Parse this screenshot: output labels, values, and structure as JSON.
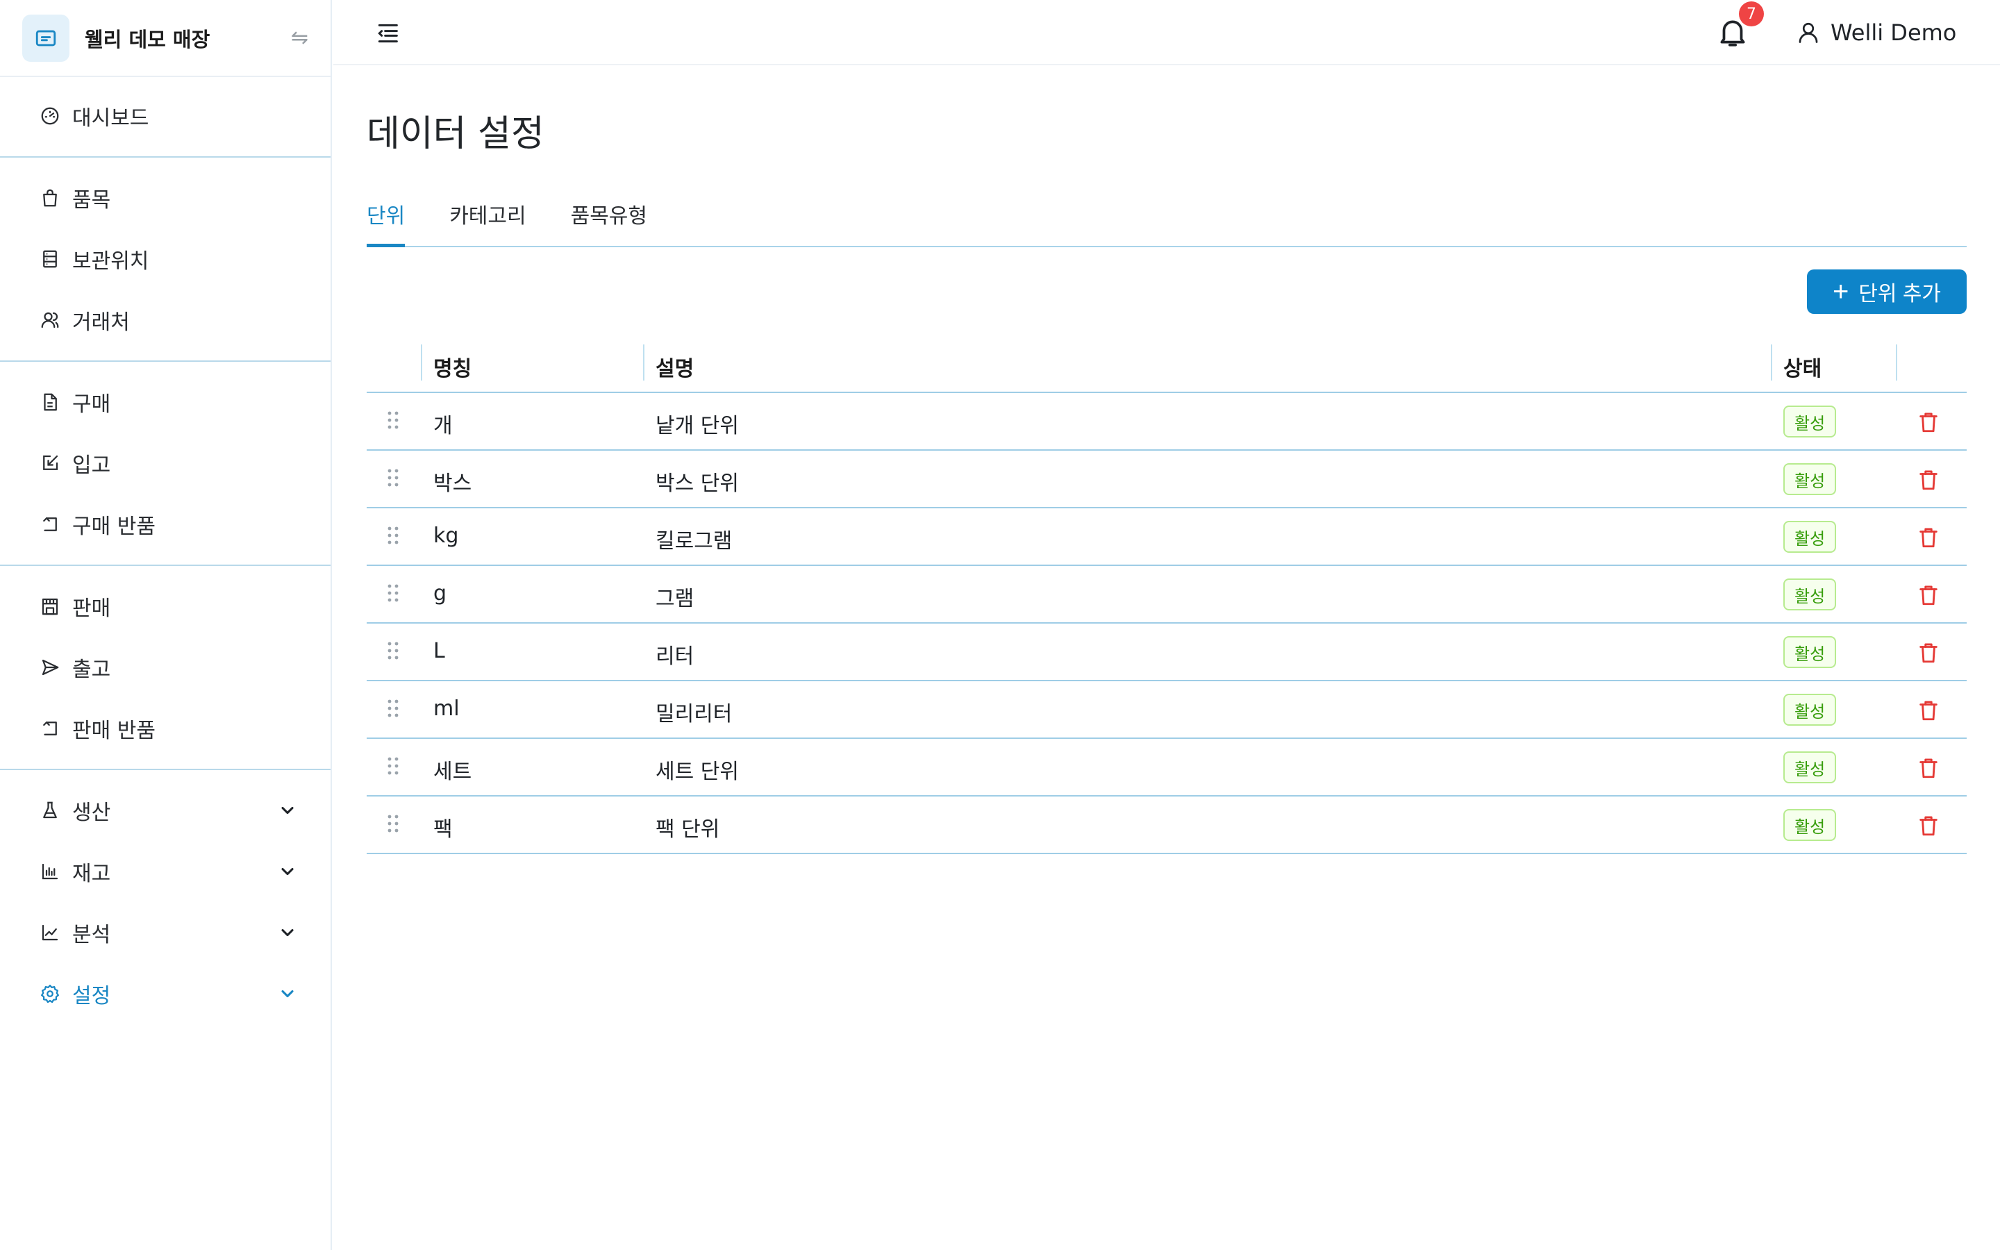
{
  "brand": {
    "name": "웰리 데모 매장"
  },
  "nav": {
    "dashboard": "대시보드",
    "items": "품목",
    "storage": "보관위치",
    "partners": "거래처",
    "purchase": "구매",
    "receiving": "입고",
    "purchase_return": "구매 반품",
    "sales": "판매",
    "shipping": "출고",
    "sales_return": "판매 반품",
    "production": "생산",
    "inventory": "재고",
    "analysis": "분석",
    "settings": "설정"
  },
  "header": {
    "notification_count": "7",
    "user_name": "Welli Demo"
  },
  "page": {
    "title": "데이터 설정"
  },
  "tabs": [
    "단위",
    "카테고리",
    "품목유형"
  ],
  "add_button_label": "단위 추가",
  "table": {
    "headers": {
      "name": "명칭",
      "description": "설명",
      "status": "상태"
    },
    "rows": [
      {
        "name": "개",
        "description": "낱개 단위",
        "status": "활성"
      },
      {
        "name": "박스",
        "description": "박스 단위",
        "status": "활성"
      },
      {
        "name": "kg",
        "description": "킬로그램",
        "status": "활성"
      },
      {
        "name": "g",
        "description": "그램",
        "status": "활성"
      },
      {
        "name": "L",
        "description": "리터",
        "status": "활성"
      },
      {
        "name": "ml",
        "description": "밀리리터",
        "status": "활성"
      },
      {
        "name": "세트",
        "description": "세트 단위",
        "status": "활성"
      },
      {
        "name": "팩",
        "description": "팩 단위",
        "status": "활성"
      }
    ]
  },
  "colors": {
    "accent": "#1a87c4",
    "primary_button": "#0e84c9",
    "danger": "#e53935",
    "status_green": "#389e0d"
  }
}
